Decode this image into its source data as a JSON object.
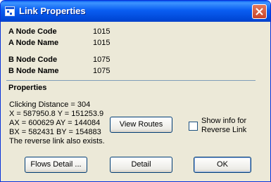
{
  "window": {
    "title": "Link Properties"
  },
  "a_node": {
    "code_label": "A Node Code",
    "code_value": "1015",
    "name_label": "A Node Name",
    "name_value": "1015"
  },
  "b_node": {
    "code_label": "B Node Code",
    "code_value": "1075",
    "name_label": "B Node Name",
    "name_value": "1075"
  },
  "properties": {
    "heading": "Properties",
    "lines": [
      "Clicking Distance = 304",
      "X = 587950.8 Y = 151253.9",
      "AX = 600629 AY = 144084",
      "BX = 582431 BY = 154883",
      "The reverse link also exists."
    ]
  },
  "view_routes_button": "View Routes",
  "reverse_link_checkbox": {
    "label_line1": "Show info for",
    "label_line2": "Reverse Link",
    "checked": false
  },
  "buttons": {
    "flows_detail": "Flows Detail ...",
    "detail": "Detail",
    "ok": "OK"
  },
  "colors": {
    "titlebar": "#0a5ef2",
    "dialog_bg": "#ece9d8",
    "button_border": "#003c74"
  }
}
